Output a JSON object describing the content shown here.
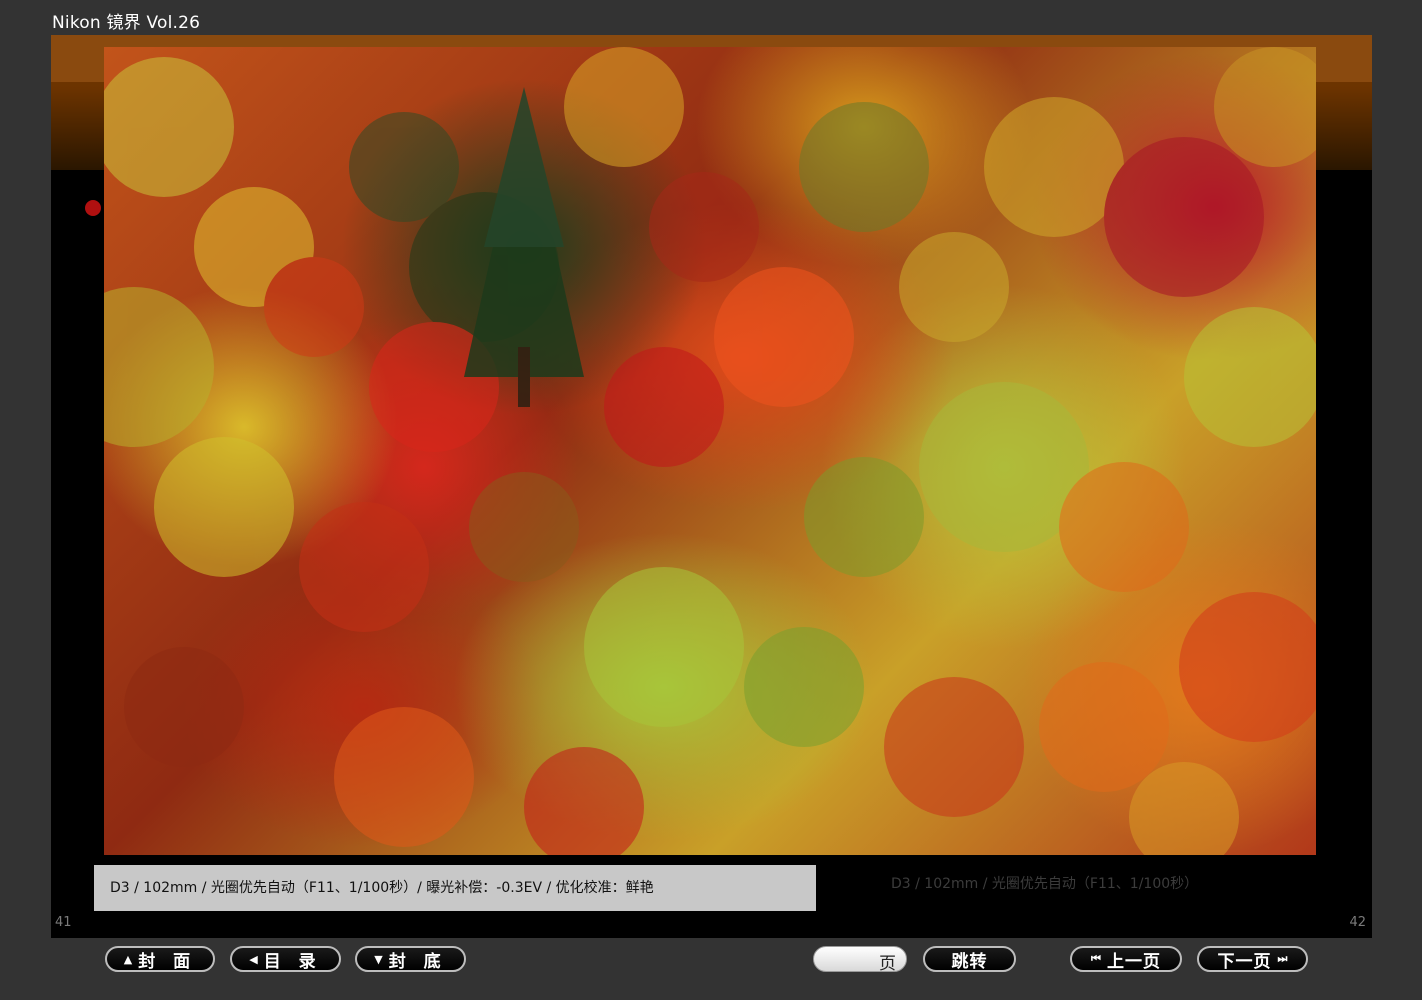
{
  "app": {
    "title": "Nikon 镜界 Vol.26"
  },
  "photo": {
    "caption": "D3 / 102mm / 光圈优先自动（F11、1/100秒）/ 曝光补偿：-0.3EV / 优化校准：鲜艳",
    "background_caption": "D3 / 102mm / 光圈优先自动（F11、1/100秒）"
  },
  "pages": {
    "left_number": "41",
    "right_number": "42"
  },
  "toolbar": {
    "cover_label": "封 面",
    "contents_label": "目 录",
    "back_cover_label": "封 底",
    "page_input_value": "",
    "page_unit": "页",
    "jump_label": "跳转",
    "prev_label": "上一页",
    "next_label": "下一页"
  },
  "colors": {
    "accent_orange": "#7a3b00",
    "bullet_red": "#b01010"
  }
}
